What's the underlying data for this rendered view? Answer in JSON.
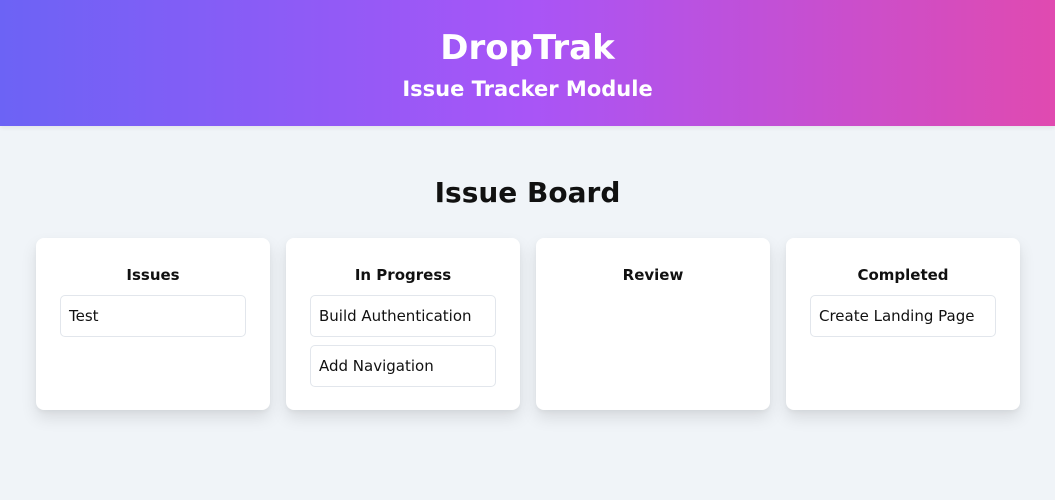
{
  "header": {
    "title": "DropTrak",
    "subtitle": "Issue Tracker Module"
  },
  "board": {
    "title": "Issue Board",
    "columns": [
      {
        "title": "Issues",
        "cards": [
          "Test"
        ]
      },
      {
        "title": "In Progress",
        "cards": [
          "Build Authentication",
          "Add Navigation"
        ]
      },
      {
        "title": "Review",
        "cards": []
      },
      {
        "title": "Completed",
        "cards": [
          "Create Landing Page"
        ]
      }
    ]
  },
  "colors": {
    "header_gradient_start": "#6c63f5",
    "header_gradient_mid": "#a855f7",
    "header_gradient_end": "#e04ab0",
    "page_background": "#f0f4f8"
  }
}
